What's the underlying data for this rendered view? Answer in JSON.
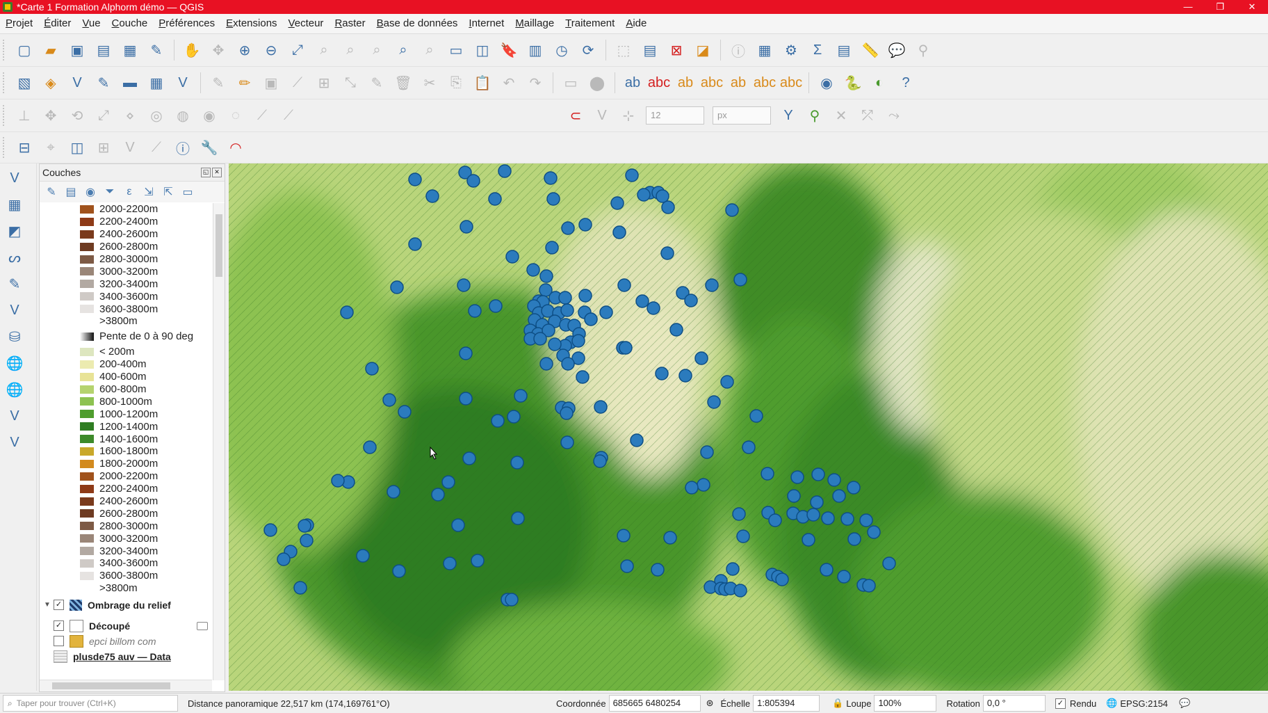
{
  "window": {
    "title": "*Carte 1 Formation Alphorm démo — QGIS",
    "minimize": "—",
    "restore": "❐",
    "close": "✕"
  },
  "menu": [
    "Projet",
    "Éditer",
    "Vue",
    "Couche",
    "Préférences",
    "Extensions",
    "Vecteur",
    "Raster",
    "Base de données",
    "Internet",
    "Maillage",
    "Traitement",
    "Aide"
  ],
  "snapping": {
    "tolerance": "12",
    "unit": "px"
  },
  "layers_panel": {
    "title": "Couches",
    "legend_top": [
      {
        "label": "2000-2200m",
        "color": "#a0521c"
      },
      {
        "label": "2200-2400m",
        "color": "#8e3a17"
      },
      {
        "label": "2400-2600m",
        "color": "#7a3a1c"
      },
      {
        "label": "2600-2800m",
        "color": "#6e3b22"
      },
      {
        "label": "2800-3000m",
        "color": "#7d5a45"
      },
      {
        "label": "3000-3200m",
        "color": "#9a8678"
      },
      {
        "label": "3200-3400m",
        "color": "#b2a9a2"
      },
      {
        "label": "3400-3600m",
        "color": "#cfcac6"
      },
      {
        "label": "3600-3800m",
        "color": "#e6e3e1"
      },
      {
        "label": ">3800m",
        "color": ""
      }
    ],
    "slope_label": "Pente de 0 à 90 deg",
    "legend_bottom": [
      {
        "label": "< 200m",
        "color": "#dde6bf"
      },
      {
        "label": "200-400m",
        "color": "#ecebb0"
      },
      {
        "label": "400-600m",
        "color": "#e8e396"
      },
      {
        "label": "600-800m",
        "color": "#b5d36e"
      },
      {
        "label": "800-1000m",
        "color": "#8dc251"
      },
      {
        "label": "1000-1200m",
        "color": "#4f9d2e"
      },
      {
        "label": "1200-1400m",
        "color": "#2f7d22"
      },
      {
        "label": "1400-1600m",
        "color": "#3d8a2a"
      },
      {
        "label": "1600-1800m",
        "color": "#c9a82a"
      },
      {
        "label": "1800-2000m",
        "color": "#d28a1e"
      },
      {
        "label": "2000-2200m",
        "color": "#a0521c"
      },
      {
        "label": "2200-2400m",
        "color": "#8e3a17"
      },
      {
        "label": "2400-2600m",
        "color": "#7a3a1c"
      },
      {
        "label": "2600-2800m",
        "color": "#6e3b22"
      },
      {
        "label": "2800-3000m",
        "color": "#7d5a45"
      },
      {
        "label": "3000-3200m",
        "color": "#9a8678"
      },
      {
        "label": "3200-3400m",
        "color": "#b2a9a2"
      },
      {
        "label": "3400-3600m",
        "color": "#cfcac6"
      },
      {
        "label": "3600-3800m",
        "color": "#e6e3e1"
      },
      {
        "label": ">3800m",
        "color": ""
      }
    ],
    "layers": [
      {
        "name": "Ombrage du relief",
        "checked": true,
        "bold": true
      },
      {
        "name": "Découpé",
        "checked": true,
        "bold": true
      },
      {
        "name": "epci billom com",
        "checked": false,
        "italic": true
      },
      {
        "name": "plusde75 auv — Data",
        "checked": false,
        "bold": true,
        "underline": true
      }
    ]
  },
  "statusbar": {
    "search_placeholder": "Taper pour trouver (Ctrl+K)",
    "message": "Distance panoramique 22,517 km (174,169761°O)",
    "coord_label": "Coordonnée",
    "coord_value": "685665  6480254",
    "scale_label": "Échelle",
    "scale_value": "1:805394",
    "magnifier_label": "Loupe",
    "magnifier_value": "100%",
    "rotation_label": "Rotation",
    "rotation_value": "0,0 °",
    "render_label": "Rendu",
    "crs": "EPSG:2154"
  },
  "map": {
    "point_color": "#2b7bbd",
    "point_stroke": "#0e4f86"
  }
}
